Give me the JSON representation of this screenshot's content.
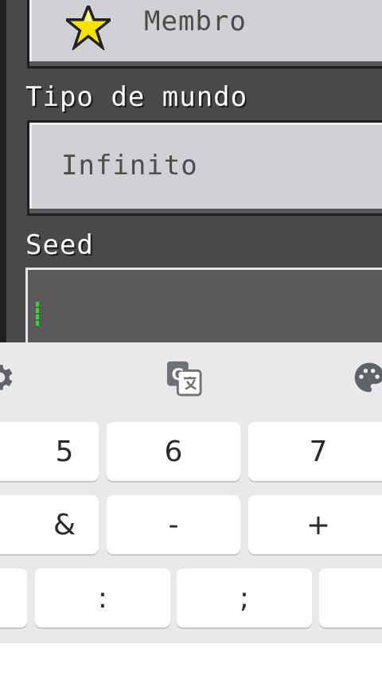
{
  "settings": {
    "member_button": {
      "label": "Membro",
      "icon": "star-icon"
    },
    "world_type": {
      "label": "Tipo de mundo",
      "value": "Infinito"
    },
    "seed": {
      "label": "Seed",
      "value": ""
    }
  },
  "keyboard": {
    "toolbar": {
      "icons": [
        "gear-icon",
        "translate-icon",
        "palette-icon"
      ]
    },
    "rows": [
      [
        "5",
        "6",
        "7"
      ],
      [
        "&",
        "-",
        "+"
      ],
      [
        "",
        ":",
        ";",
        ""
      ]
    ]
  },
  "colors": {
    "panel_bg": "#313233",
    "button_face": "#d0d1d4",
    "caret": "#23e023",
    "keyboard_bg": "#e9e9ec",
    "key_bg": "#ffffff"
  }
}
